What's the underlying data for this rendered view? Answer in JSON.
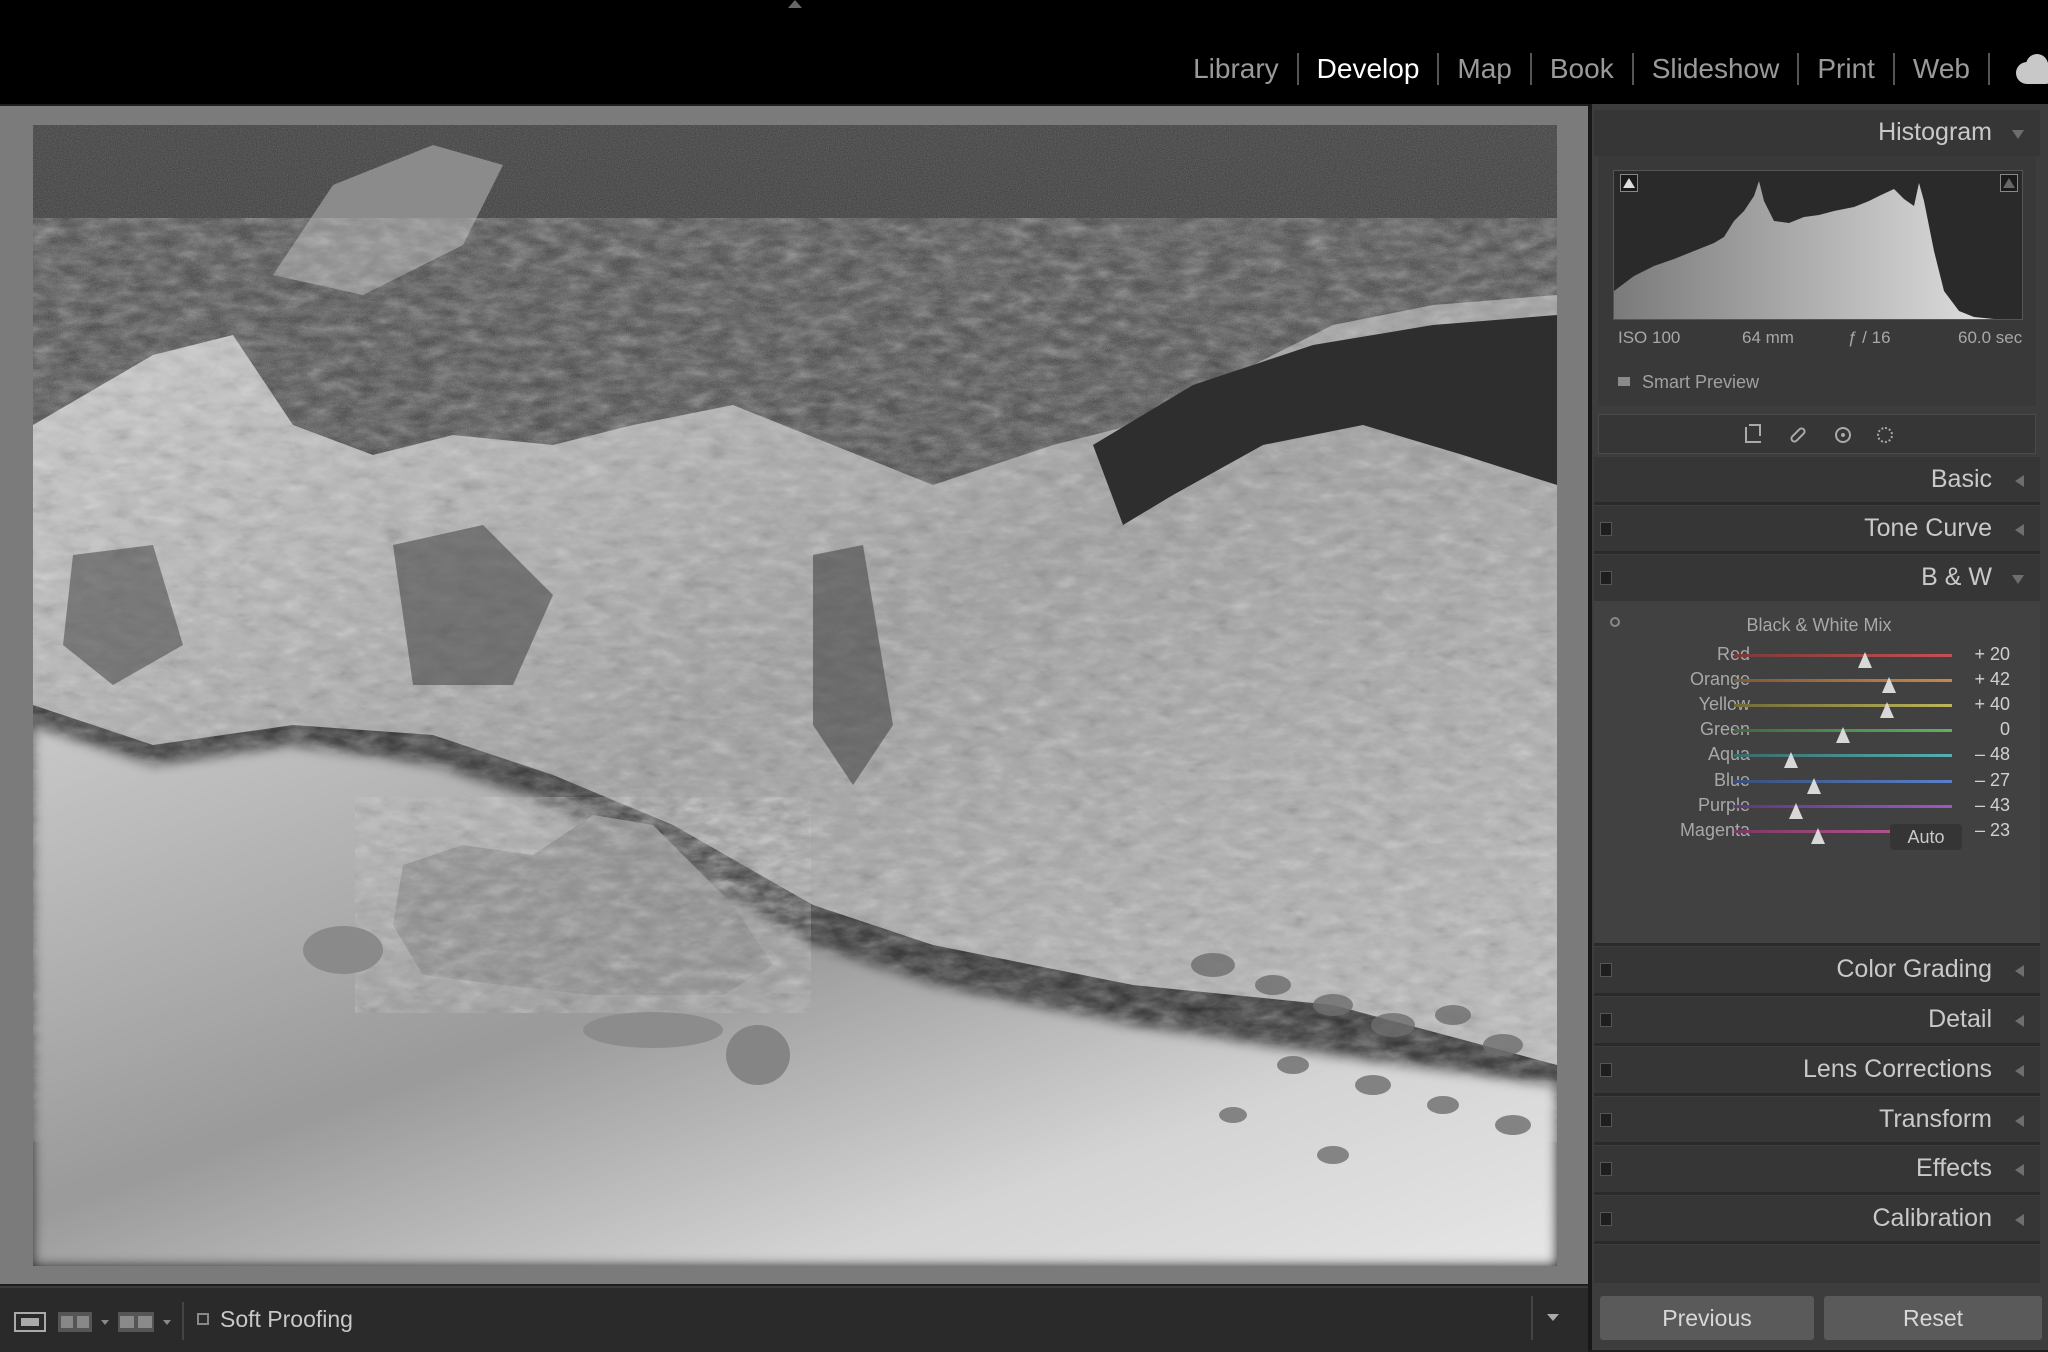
{
  "app": {
    "modules": [
      {
        "label": "Library",
        "active": false
      },
      {
        "label": "Develop",
        "active": true
      },
      {
        "label": "Map",
        "active": false
      },
      {
        "label": "Book",
        "active": false
      },
      {
        "label": "Slideshow",
        "active": false
      },
      {
        "label": "Print",
        "active": false
      },
      {
        "label": "Web",
        "active": false
      }
    ]
  },
  "toolbar": {
    "soft_proofing_label": "Soft Proofing",
    "soft_proofing_checked": false
  },
  "histogram": {
    "title": "Histogram",
    "iso": "ISO 100",
    "focal_length": "64 mm",
    "aperture": "ƒ / 16",
    "shutter": "60.0 sec",
    "smart_preview_label": "Smart Preview"
  },
  "panels": {
    "basic": "Basic",
    "tone_curve": "Tone Curve",
    "bw": "B & W",
    "color_grading": "Color Grading",
    "detail": "Detail",
    "lens_corrections": "Lens Corrections",
    "transform": "Transform",
    "effects": "Effects",
    "calibration": "Calibration"
  },
  "bw_mix": {
    "title": "Black & White Mix",
    "auto_label": "Auto",
    "sliders": [
      {
        "label": "Red",
        "value": 20,
        "display": "+ 20",
        "colors": [
          "#7a3a3a",
          "#c65050"
        ]
      },
      {
        "label": "Orange",
        "value": 42,
        "display": "+ 42",
        "colors": [
          "#7a5a3a",
          "#c8884a"
        ]
      },
      {
        "label": "Yellow",
        "value": 40,
        "display": "+ 40",
        "colors": [
          "#6f6a3a",
          "#bdb55a"
        ]
      },
      {
        "label": "Green",
        "value": 0,
        "display": "0",
        "colors": [
          "#3e6a3e",
          "#62b062"
        ]
      },
      {
        "label": "Aqua",
        "value": -48,
        "display": "– 48",
        "colors": [
          "#3a6a6a",
          "#55b0b0"
        ]
      },
      {
        "label": "Blue",
        "value": -27,
        "display": "– 27",
        "colors": [
          "#3a4f78",
          "#5880c8"
        ]
      },
      {
        "label": "Purple",
        "value": -43,
        "display": "– 43",
        "colors": [
          "#5a3a78",
          "#9a5ac8"
        ]
      },
      {
        "label": "Magenta",
        "value": -23,
        "display": "– 23",
        "colors": [
          "#783a60",
          "#c85aa0"
        ]
      }
    ]
  },
  "footer": {
    "previous_label": "Previous",
    "reset_label": "Reset"
  }
}
